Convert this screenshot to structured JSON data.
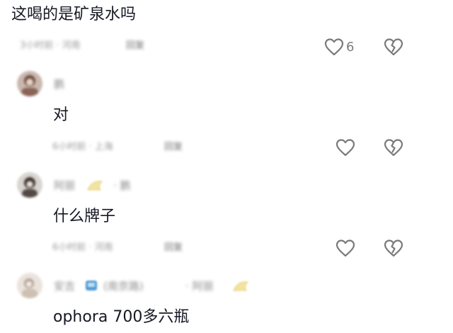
{
  "comments": [
    {
      "text": "这喝的是矿泉水吗",
      "meta": "3小时前 · 河南",
      "reply": "回复",
      "likes": "6"
    },
    {
      "author": "鹏",
      "text": "对",
      "meta": "6小时前 · 上海",
      "reply": "回复"
    },
    {
      "author": "阿丽",
      "author_suffix": "· 鹏",
      "text": "什么牌子",
      "meta": "6小时前 · 河南",
      "reply": "回复"
    },
    {
      "author": "安吉",
      "author_tag": "(南京路)",
      "author_suffix": "· 阿丽",
      "text": "ophora 700多六瓶"
    }
  ]
}
